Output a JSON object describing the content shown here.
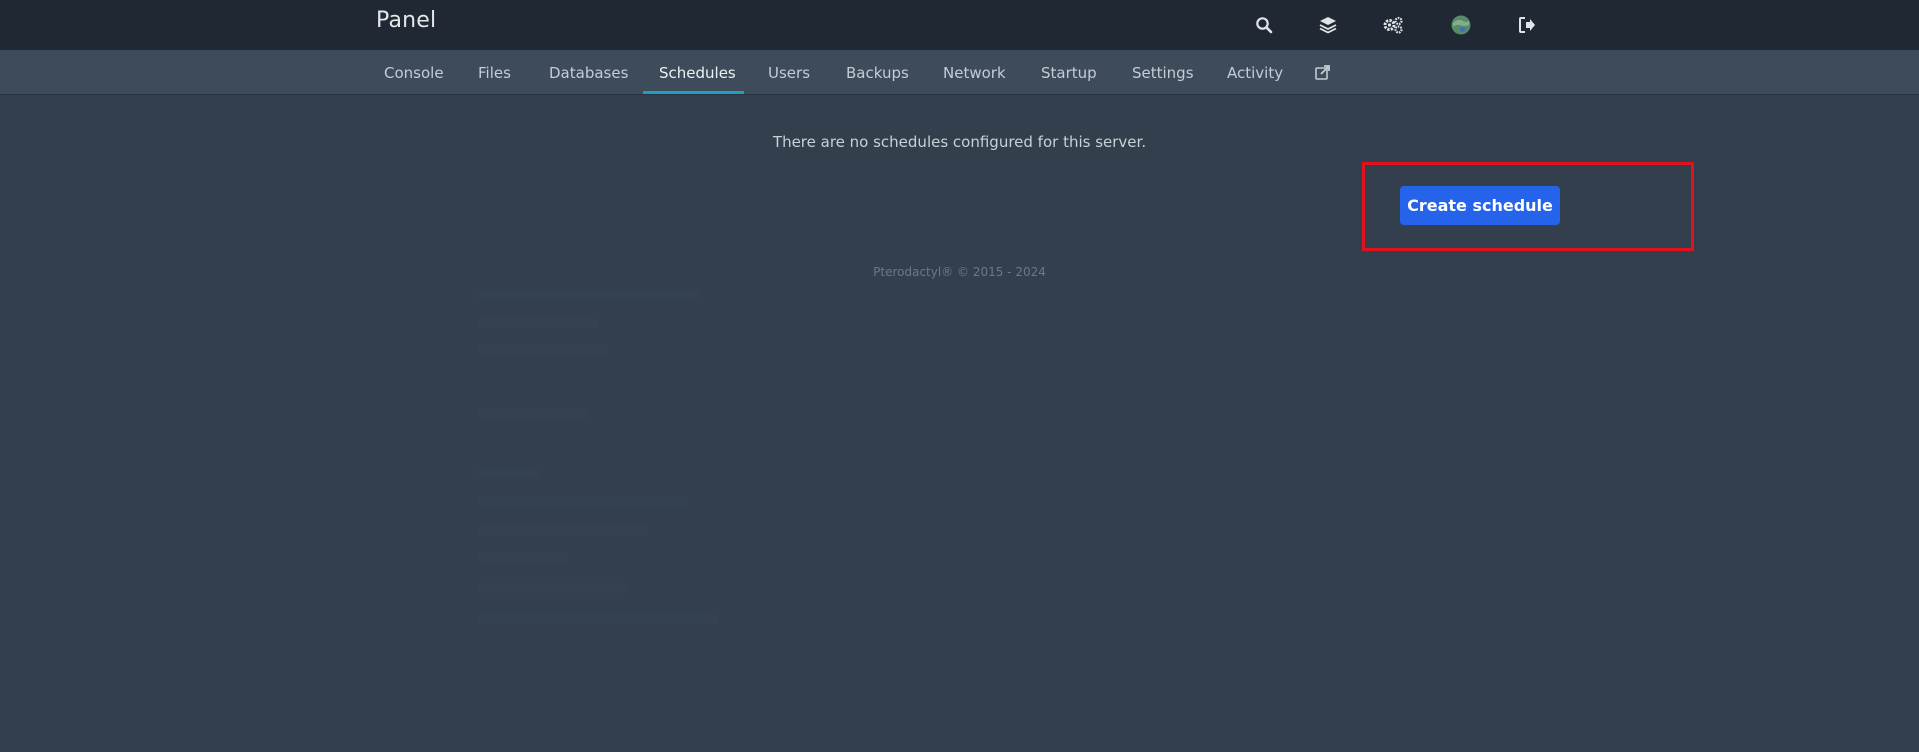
{
  "header": {
    "brand": "Panel",
    "icons": [
      "search-icon",
      "layers-icon",
      "cogs-icon",
      "avatar",
      "sign-out-icon"
    ]
  },
  "nav": {
    "tabs": [
      {
        "label": "Console"
      },
      {
        "label": "Files"
      },
      {
        "label": "Databases"
      },
      {
        "label": "Schedules",
        "active": true
      },
      {
        "label": "Users"
      },
      {
        "label": "Backups"
      },
      {
        "label": "Network"
      },
      {
        "label": "Startup"
      },
      {
        "label": "Settings"
      },
      {
        "label": "Activity"
      }
    ],
    "external_icon": "external-link-icon"
  },
  "main": {
    "empty_message": "There are no schedules configured for this server.",
    "create_label": "Create schedule"
  },
  "footer": {
    "text": "Pterodactyl® © 2015 - 2024"
  },
  "colors": {
    "primary_button": "#2563eb",
    "active_tab_underline": "#1f9dc2",
    "highlight": "#e0121d"
  }
}
